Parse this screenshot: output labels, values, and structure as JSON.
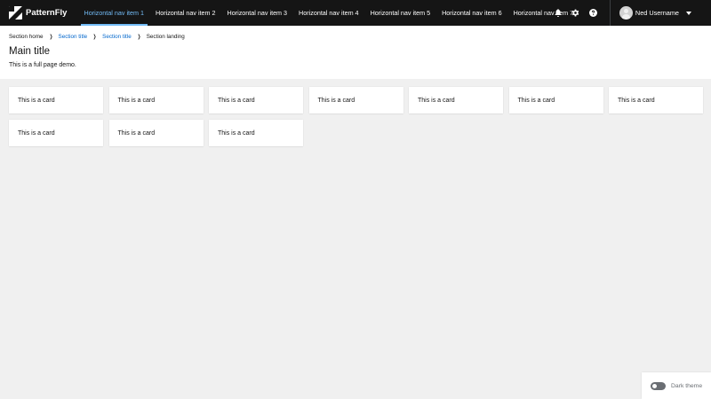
{
  "masthead": {
    "brand": "PatternFly",
    "nav": [
      {
        "label": "Horizontal nav item 1",
        "active": true
      },
      {
        "label": "Horizontal nav item 2",
        "active": false
      },
      {
        "label": "Horizontal nav item 3",
        "active": false
      },
      {
        "label": "Horizontal nav item 4",
        "active": false
      },
      {
        "label": "Horizontal nav item 5",
        "active": false
      },
      {
        "label": "Horizontal nav item 6",
        "active": false
      },
      {
        "label": "Horizontal nav item 7",
        "active": false
      }
    ],
    "tools": {
      "notifications_icon": "bell-icon",
      "settings_icon": "gear-icon",
      "help_icon": "question-circle-icon"
    },
    "user": {
      "name": "Ned Username",
      "avatar_icon": "avatar-icon"
    },
    "colors": {
      "background": "#151515",
      "active_nav": "#73bcf7"
    }
  },
  "breadcrumb": [
    {
      "label": "Section home",
      "link": false
    },
    {
      "label": "Section title",
      "link": true
    },
    {
      "label": "Section title",
      "link": true
    },
    {
      "label": "Section landing",
      "link": false
    }
  ],
  "page": {
    "title": "Main title",
    "description": "This is a full page demo."
  },
  "cards": [
    {
      "label": "This is a card"
    },
    {
      "label": "This is a card"
    },
    {
      "label": "This is a card"
    },
    {
      "label": "This is a card"
    },
    {
      "label": "This is a card"
    },
    {
      "label": "This is a card"
    },
    {
      "label": "This is a card"
    },
    {
      "label": "This is a card"
    },
    {
      "label": "This is a card"
    },
    {
      "label": "This is a card"
    }
  ],
  "theme_switch": {
    "label": "Dark theme",
    "checked": false
  }
}
